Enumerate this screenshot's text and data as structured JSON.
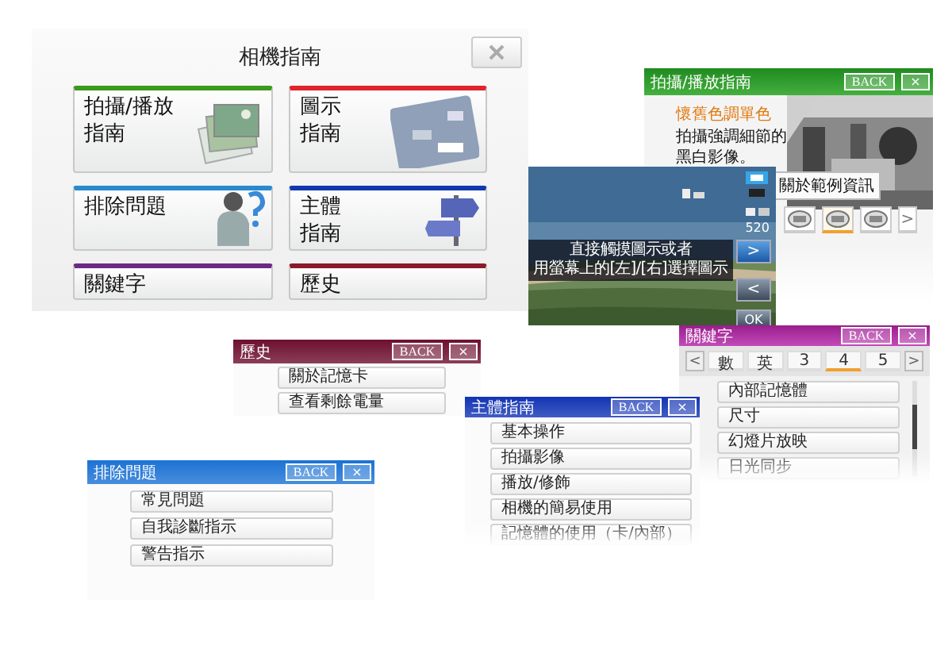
{
  "camera_guide": {
    "title": "相機指南",
    "cards": [
      {
        "lines": [
          "拍攝/播放",
          "指南"
        ],
        "color": "#3c9a1e",
        "kind": "photos"
      },
      {
        "lines": [
          "圖示",
          "指南"
        ],
        "color": "#e0242c",
        "kind": "display"
      },
      {
        "lines": [
          "排除問題"
        ],
        "color": "#2a8ad0",
        "kind": "question"
      },
      {
        "lines": [
          "主體",
          "指南"
        ],
        "color": "#1238b0",
        "kind": "signpost"
      },
      {
        "lines": [
          "關鍵字"
        ],
        "color": "#6a2a86",
        "kind": "plain"
      },
      {
        "lines": [
          "歷史"
        ],
        "color": "#8a1a2a",
        "kind": "plain"
      }
    ]
  },
  "playback_guide": {
    "title": "拍攝/播放指南",
    "back": "BACK",
    "close": "×",
    "mode": "懷舊色調單色",
    "description": [
      "拍攝強調細節的",
      "黑白影像。"
    ],
    "info_button": "關於範例資訊",
    "effects": [
      {
        "selected": false
      },
      {
        "selected": true
      },
      {
        "selected": false
      }
    ],
    "more": ">"
  },
  "icon_guide": {
    "caption": [
      "直接觸摸圖示或者",
      "用螢幕上的[左]/[右]選擇圖示"
    ],
    "shots": "520",
    "next": ">",
    "prev": "<",
    "ok": "OK"
  },
  "keywords": {
    "title": "關鍵字",
    "back": "BACK",
    "close": "×",
    "prev": "<",
    "next": ">",
    "tabs": [
      {
        "label": "數",
        "selected": false
      },
      {
        "label": "英",
        "selected": false
      },
      {
        "label": "3",
        "selected": false
      },
      {
        "label": "4",
        "selected": true
      },
      {
        "label": "5",
        "selected": false
      }
    ],
    "items": [
      "內部記憶體",
      "尺寸",
      "幻燈片放映",
      "日光同步"
    ]
  },
  "dialogs": [
    {
      "title": "歷史",
      "color": "#6e0f30",
      "back": "BACK",
      "close": "×",
      "items": [
        "關於記憶卡",
        "查看剩餘電量"
      ]
    },
    {
      "title": "主體指南",
      "color": "#1234b4",
      "back": "BACK",
      "close": "×",
      "items": [
        "基本操作",
        "拍攝影像",
        "播放/修飾",
        "相機的簡易使用",
        "記憶體的使用（卡/內部）"
      ]
    },
    {
      "title": "排除問題",
      "color": "#1c72d4",
      "back": "BACK",
      "close": "×",
      "items": [
        "常見問題",
        "自我診斷指示",
        "警告指示"
      ]
    }
  ]
}
